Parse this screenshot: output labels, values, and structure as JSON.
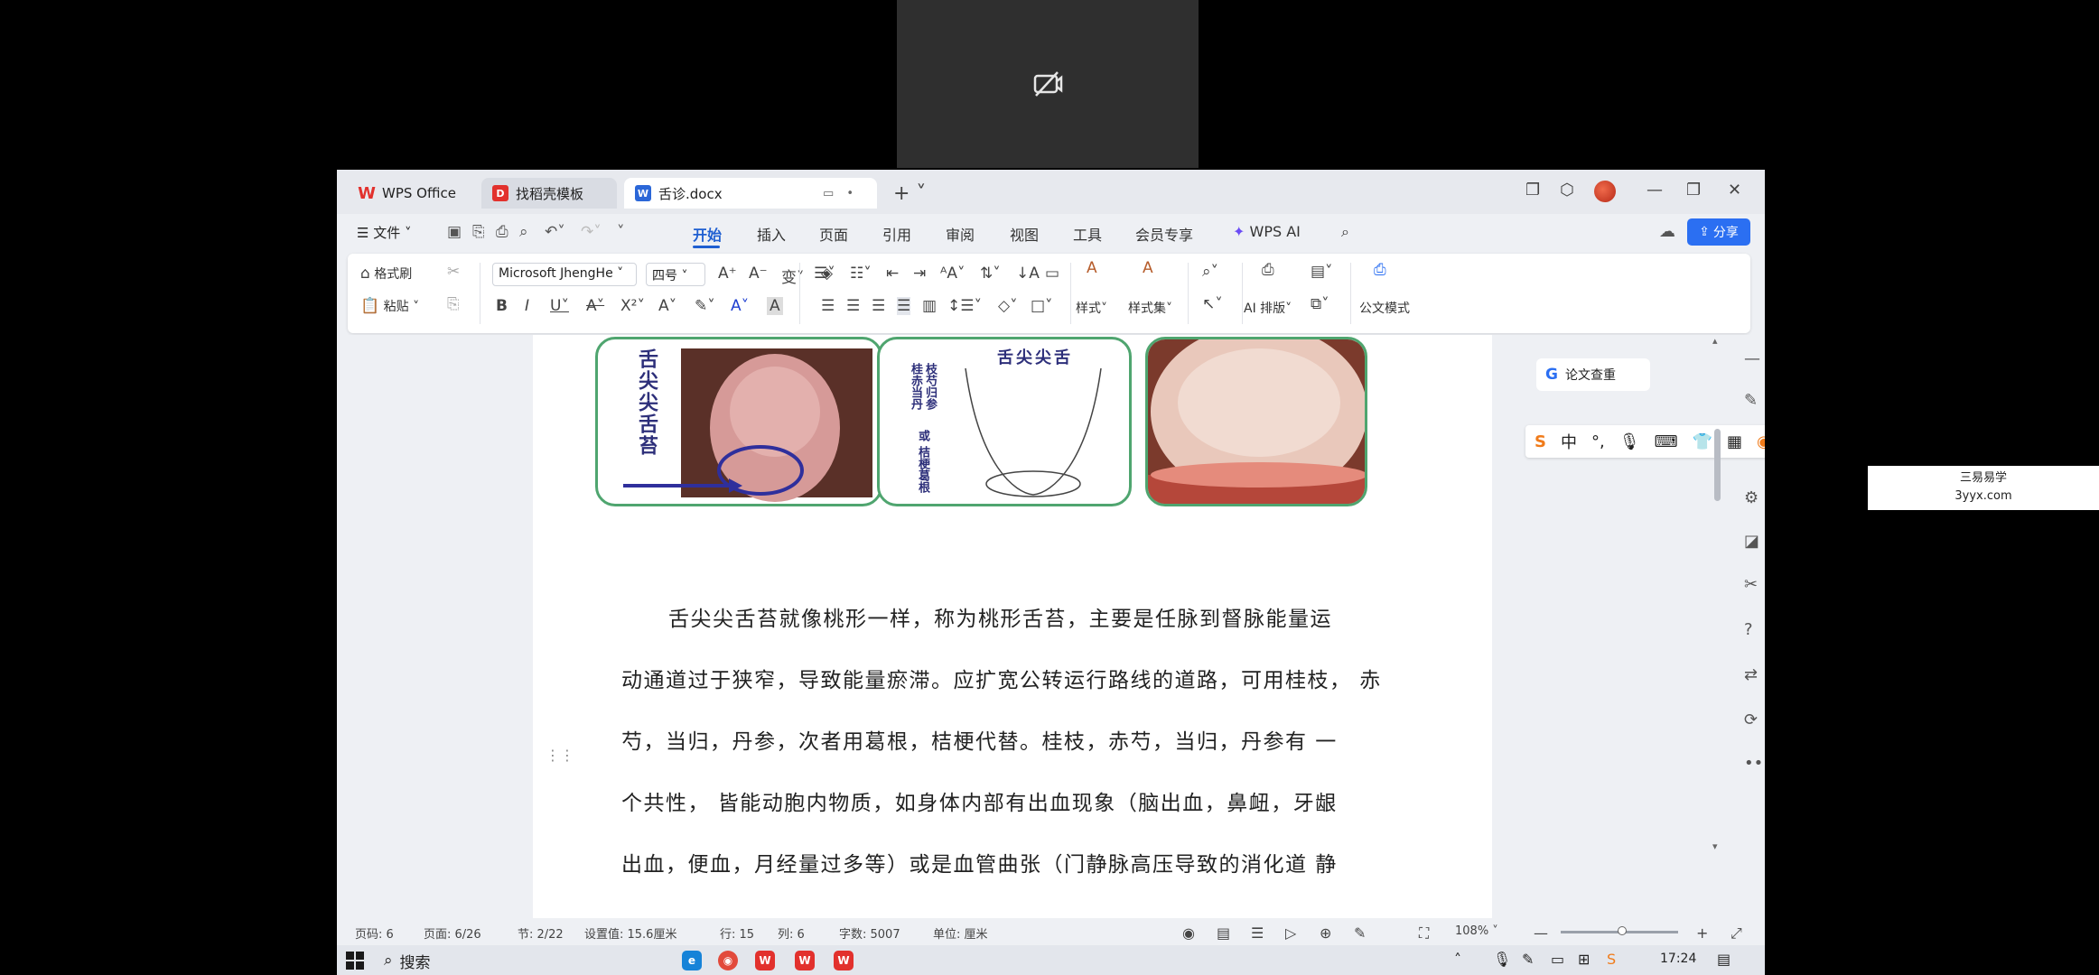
{
  "watermark": {
    "line1": "三易易学",
    "line2": "3yyx.com"
  },
  "titlebar": {
    "tabs": [
      {
        "label": "WPS Office"
      },
      {
        "label": "找稻壳模板"
      },
      {
        "label": "舌诊.docx"
      }
    ]
  },
  "menubar": {
    "file_label": "文件",
    "items": [
      "开始",
      "插入",
      "页面",
      "引用",
      "审阅",
      "视图",
      "工具",
      "会员专享"
    ],
    "wps_ai": "WPS AI",
    "share_label": "分享"
  },
  "ribbon": {
    "format_painter": "格式刷",
    "paste": "粘贴",
    "font_name": "Microsoft JhengHe",
    "font_size": "四号",
    "styles": "样式",
    "style_set": "样式集",
    "ai_layout": "AI 排版",
    "official_doc": "公文模式"
  },
  "document": {
    "figures": {
      "fig1_label": "舌尖尖舌苔",
      "fig2_title": "舌尖尖舌",
      "fig2_col1": "桂赤当丹",
      "fig2_col2": "枝芍归参",
      "fig2_col3": "或",
      "fig2_col4": "桔梗葛根"
    },
    "paragraph_lines": [
      "舌尖尖舌苔就像桃形一样，称为桃形舌苔，主要是任脉到督脉能量运",
      "动通道过于狭窄，导致能量瘀滞。应扩宽公转运行路线的道路，可用桂枝， 赤",
      "芍，当归，丹参，次者用葛根，桔梗代替。桂枝，赤芍，当归，丹参有 一",
      "个共性， 皆能动胞内物质，如身体内部有出血现象（脑出血，鼻衄，牙龈",
      "出血，便血，月经量过多等）或是血管曲张（门静脉高压导致的消化道  静"
    ]
  },
  "side_panel": {
    "thesis_check": "论文查重",
    "ime_mode": "中"
  },
  "statusbar": {
    "page_code": "页码: 6",
    "pages": "页面: 6/26",
    "section": "节: 2/22",
    "setting": "设置值: 15.6厘米",
    "row": "行: 15",
    "col": "列: 6",
    "word_count": "字数: 5007",
    "unit": "单位: 厘米",
    "zoom": "108%"
  },
  "taskbar": {
    "search_label": "搜索",
    "clock": "17:24"
  }
}
